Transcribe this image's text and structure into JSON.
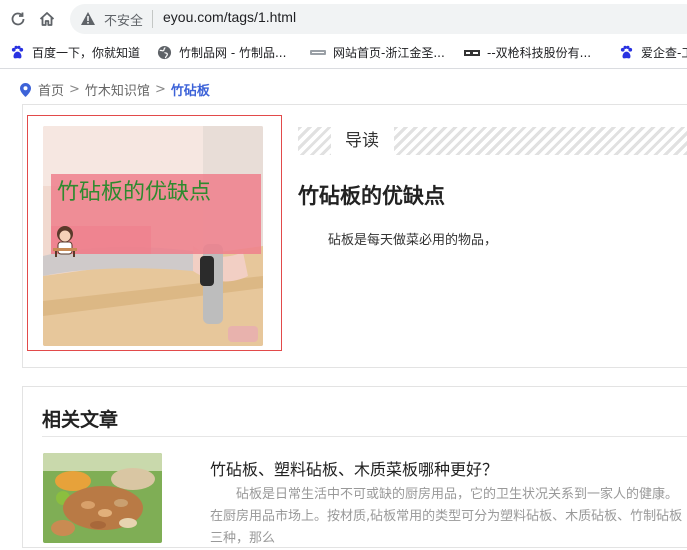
{
  "browser": {
    "security_label": "不安全",
    "url": "eyou.com/tags/1.html"
  },
  "bookmarks": [
    {
      "label": "百度一下，你就知道",
      "icon": "baidu-paw-icon"
    },
    {
      "label": "竹制品网 - 竹制品...",
      "icon": "globe-icon"
    },
    {
      "label": "网站首页-浙江金圣...",
      "icon": "site-logo-icon"
    },
    {
      "label": "--双枪科技股份有...",
      "icon": "shuangqiang-logo-icon"
    },
    {
      "label": "爱企查-工",
      "icon": "baidu-paw-icon"
    }
  ],
  "breadcrumb": {
    "items": [
      "首页",
      "竹木知识馆"
    ],
    "current": "竹砧板",
    "separator": ">"
  },
  "featured": {
    "thumbnail_caption": "竹砧板的优缺点",
    "section_label": "导读",
    "title": "竹砧板的优缺点",
    "summary": "砧板是每天做菜必用的物品，"
  },
  "related": {
    "heading": "相关文章",
    "items": [
      {
        "title": "竹砧板、塑料砧板、木质菜板哪种更好？",
        "excerpt": "砧板是日常生活中不可或缺的厨房用品，它的卫生状况关系到一家人的健康。在厨房用品市场上。按材质,砧板常用的类型可分为塑料砧板、木质砧板、竹制砧板三种，那么"
      }
    ]
  },
  "colors": {
    "accent": "#3d63d8",
    "thumb_border": "#e24a4a",
    "caption_green": "#2f8a2f"
  }
}
